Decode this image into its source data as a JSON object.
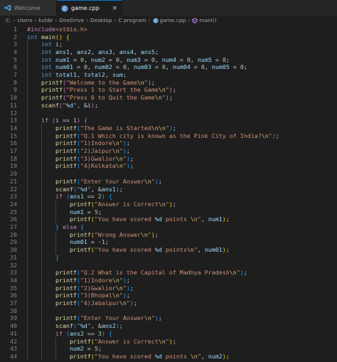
{
  "tabs": [
    {
      "label": "Welcome",
      "active": false
    },
    {
      "label": "game.cpp",
      "active": true
    }
  ],
  "breadcrumb": [
    "C:",
    "Users",
    "kulde",
    "OneDrive",
    "Desktop",
    "C program",
    "game.cpp",
    "main()"
  ],
  "colors": {
    "background": "#1e1e1e",
    "keyword": "#569cd6",
    "function": "#dcdcaa",
    "string": "#ce9178",
    "number": "#b5cea8",
    "preprocessor": "#c586c0",
    "variable": "#9cdcfe",
    "line_number": "#858585"
  },
  "code_lines": [
    [
      [
        "pp",
        "#include"
      ],
      [
        "st",
        "<stdio.h>"
      ]
    ],
    [
      [
        "ty",
        "int "
      ],
      [
        "fn",
        "main"
      ],
      [
        "br1",
        "() {"
      ]
    ],
    [
      [
        "ty",
        "    int "
      ],
      [
        "va",
        "i"
      ],
      [
        "pl",
        ";"
      ]
    ],
    [
      [
        "ty",
        "    int "
      ],
      [
        "va",
        "ans1"
      ],
      [
        "pl",
        ", "
      ],
      [
        "va",
        "ans2"
      ],
      [
        "pl",
        ", "
      ],
      [
        "va",
        "ans3"
      ],
      [
        "pl",
        ", "
      ],
      [
        "va",
        "ans4"
      ],
      [
        "pl",
        ", "
      ],
      [
        "va",
        "ans5"
      ],
      [
        "pl",
        ";"
      ]
    ],
    [
      [
        "ty",
        "    int "
      ],
      [
        "va",
        "num1"
      ],
      [
        "pl",
        " = "
      ],
      [
        "nu",
        "0"
      ],
      [
        "pl",
        ", "
      ],
      [
        "va",
        "num2"
      ],
      [
        "pl",
        " = "
      ],
      [
        "nu",
        "0"
      ],
      [
        "pl",
        ", "
      ],
      [
        "va",
        "num3"
      ],
      [
        "pl",
        " = "
      ],
      [
        "nu",
        "0"
      ],
      [
        "pl",
        ", "
      ],
      [
        "va",
        "num4"
      ],
      [
        "pl",
        " = "
      ],
      [
        "nu",
        "0"
      ],
      [
        "pl",
        ", "
      ],
      [
        "va",
        "num5"
      ],
      [
        "pl",
        " = "
      ],
      [
        "nu",
        "0"
      ],
      [
        "pl",
        ";"
      ]
    ],
    [
      [
        "ty",
        "    int "
      ],
      [
        "va",
        "num01"
      ],
      [
        "pl",
        " = "
      ],
      [
        "nu",
        "0"
      ],
      [
        "pl",
        ", "
      ],
      [
        "va",
        "num02"
      ],
      [
        "pl",
        " = "
      ],
      [
        "nu",
        "0"
      ],
      [
        "pl",
        ", "
      ],
      [
        "va",
        "num03"
      ],
      [
        "pl",
        " = "
      ],
      [
        "nu",
        "0"
      ],
      [
        "pl",
        ", "
      ],
      [
        "va",
        "num04"
      ],
      [
        "pl",
        " = "
      ],
      [
        "nu",
        "0"
      ],
      [
        "pl",
        ", "
      ],
      [
        "va",
        "num05"
      ],
      [
        "pl",
        " = "
      ],
      [
        "nu",
        "0"
      ],
      [
        "pl",
        ";"
      ]
    ],
    [
      [
        "ty",
        "    int "
      ],
      [
        "va",
        "total1"
      ],
      [
        "pl",
        ", "
      ],
      [
        "va",
        "total2"
      ],
      [
        "pl",
        ", "
      ],
      [
        "va",
        "sum"
      ],
      [
        "pl",
        ";"
      ]
    ],
    [
      [
        "fn",
        "    printf"
      ],
      [
        "br2",
        "("
      ],
      [
        "st",
        "\"Welcome to the Game"
      ],
      [
        "es",
        "\\n"
      ],
      [
        "st",
        "\""
      ],
      [
        "br2",
        ")"
      ],
      [
        "pl",
        ";"
      ]
    ],
    [
      [
        "fn",
        "    printf"
      ],
      [
        "br2",
        "("
      ],
      [
        "st",
        "\"Press 1 to Start the Game"
      ],
      [
        "es",
        "\\n"
      ],
      [
        "st",
        "\""
      ],
      [
        "br2",
        ")"
      ],
      [
        "pl",
        ";"
      ]
    ],
    [
      [
        "fn",
        "    printf"
      ],
      [
        "br2",
        "("
      ],
      [
        "st",
        "\"Press 0 to Quit the Game"
      ],
      [
        "es",
        "\\n"
      ],
      [
        "st",
        "\""
      ],
      [
        "br2",
        ")"
      ],
      [
        "pl",
        ";"
      ]
    ],
    [
      [
        "fn",
        "    scanf"
      ],
      [
        "br2",
        "("
      ],
      [
        "st",
        "\""
      ],
      [
        "va",
        "%d"
      ],
      [
        "st",
        "\""
      ],
      [
        "pl",
        ", &"
      ],
      [
        "va",
        "i"
      ],
      [
        "br2",
        ")"
      ],
      [
        "pl",
        ";"
      ]
    ],
    [],
    [
      [
        "pp",
        "    if "
      ],
      [
        "br2",
        "("
      ],
      [
        "va",
        "i"
      ],
      [
        "pl",
        " == "
      ],
      [
        "nu",
        "1"
      ],
      [
        "br2",
        ")"
      ],
      [
        "br2",
        " {"
      ]
    ],
    [
      [
        "fn",
        "        printf"
      ],
      [
        "br3",
        "("
      ],
      [
        "st",
        "\"The Game is Started"
      ],
      [
        "es",
        "\\n\\n"
      ],
      [
        "st",
        "\""
      ],
      [
        "br3",
        ")"
      ],
      [
        "pl",
        ";"
      ]
    ],
    [
      [
        "fn",
        "        printf"
      ],
      [
        "br3",
        "("
      ],
      [
        "st",
        "\"Q.1 Which city is known as the Pink City of India?"
      ],
      [
        "es",
        "\\n"
      ],
      [
        "st",
        "\""
      ],
      [
        "br3",
        ")"
      ],
      [
        "pl",
        ";"
      ]
    ],
    [
      [
        "fn",
        "        printf"
      ],
      [
        "br3",
        "("
      ],
      [
        "st",
        "\"1)Indore"
      ],
      [
        "es",
        "\\n"
      ],
      [
        "st",
        "\""
      ],
      [
        "br3",
        ")"
      ],
      [
        "pl",
        ";"
      ]
    ],
    [
      [
        "fn",
        "        printf"
      ],
      [
        "br3",
        "("
      ],
      [
        "st",
        "\"2)Jaipur"
      ],
      [
        "es",
        "\\n"
      ],
      [
        "st",
        "\""
      ],
      [
        "br3",
        ")"
      ],
      [
        "pl",
        ";"
      ]
    ],
    [
      [
        "fn",
        "        printf"
      ],
      [
        "br3",
        "("
      ],
      [
        "st",
        "\"3)Gwalior"
      ],
      [
        "es",
        "\\n"
      ],
      [
        "st",
        "\""
      ],
      [
        "br3",
        ")"
      ],
      [
        "pl",
        ";"
      ]
    ],
    [
      [
        "fn",
        "        printf"
      ],
      [
        "br3",
        "("
      ],
      [
        "st",
        "\"4)Kolkata"
      ],
      [
        "es",
        "\\n"
      ],
      [
        "st",
        "\""
      ],
      [
        "br3",
        ")"
      ],
      [
        "pl",
        ";"
      ]
    ],
    [],
    [
      [
        "fn",
        "        printf"
      ],
      [
        "br3",
        "("
      ],
      [
        "st",
        "\"Enter Your Answer"
      ],
      [
        "es",
        "\\n"
      ],
      [
        "st",
        "\""
      ],
      [
        "br3",
        ")"
      ],
      [
        "pl",
        ";"
      ]
    ],
    [
      [
        "fn",
        "        scanf"
      ],
      [
        "br3",
        "("
      ],
      [
        "st",
        "\""
      ],
      [
        "va",
        "%d"
      ],
      [
        "st",
        "\""
      ],
      [
        "pl",
        ", &"
      ],
      [
        "va",
        "ans1"
      ],
      [
        "br3",
        ")"
      ],
      [
        "pl",
        ";"
      ]
    ],
    [
      [
        "pp",
        "        if "
      ],
      [
        "br3",
        "("
      ],
      [
        "va",
        "ans1"
      ],
      [
        "pl",
        " == "
      ],
      [
        "nu",
        "2"
      ],
      [
        "br3",
        ")"
      ],
      [
        "br3",
        " {"
      ]
    ],
    [
      [
        "fn",
        "            printf"
      ],
      [
        "br1",
        "("
      ],
      [
        "st",
        "\"Answer is Correct"
      ],
      [
        "es",
        "\\n"
      ],
      [
        "st",
        "\""
      ],
      [
        "br1",
        ")"
      ],
      [
        "pl",
        ";"
      ]
    ],
    [
      [
        "va",
        "            num1"
      ],
      [
        "pl",
        " = "
      ],
      [
        "nu",
        "5"
      ],
      [
        "pl",
        ";"
      ]
    ],
    [
      [
        "fn",
        "            printf"
      ],
      [
        "br1",
        "("
      ],
      [
        "st",
        "\"You have scored "
      ],
      [
        "va",
        "%d"
      ],
      [
        "st",
        " points "
      ],
      [
        "es",
        "\\n"
      ],
      [
        "st",
        "\""
      ],
      [
        "pl",
        ", "
      ],
      [
        "va",
        "num1"
      ],
      [
        "br1",
        ")"
      ],
      [
        "pl",
        ";"
      ]
    ],
    [
      [
        "br3",
        "        } "
      ],
      [
        "pp",
        "else "
      ],
      [
        "br3",
        "{"
      ]
    ],
    [
      [
        "fn",
        "            printf"
      ],
      [
        "br1",
        "("
      ],
      [
        "st",
        "\"Wrong Answer"
      ],
      [
        "es",
        "\\n"
      ],
      [
        "st",
        "\""
      ],
      [
        "br1",
        ")"
      ],
      [
        "pl",
        ";"
      ]
    ],
    [
      [
        "va",
        "            num01"
      ],
      [
        "pl",
        " = -"
      ],
      [
        "nu",
        "1"
      ],
      [
        "pl",
        ";"
      ]
    ],
    [
      [
        "fn",
        "            printf"
      ],
      [
        "br1",
        "("
      ],
      [
        "st",
        "\"You have scored "
      ],
      [
        "va",
        "%d"
      ],
      [
        "st",
        " points"
      ],
      [
        "es",
        "\\n"
      ],
      [
        "st",
        "\""
      ],
      [
        "pl",
        ", "
      ],
      [
        "va",
        "num01"
      ],
      [
        "br1",
        ")"
      ],
      [
        "pl",
        ";"
      ]
    ],
    [
      [
        "br3",
        "        }"
      ]
    ],
    [],
    [
      [
        "fn",
        "        printf"
      ],
      [
        "br3",
        "("
      ],
      [
        "st",
        "\"Q.2 What is the Capital of Madhya Pradesh"
      ],
      [
        "es",
        "\\n"
      ],
      [
        "st",
        "\""
      ],
      [
        "br3",
        ")"
      ],
      [
        "pl",
        ";"
      ]
    ],
    [
      [
        "fn",
        "        printf"
      ],
      [
        "br3",
        "("
      ],
      [
        "st",
        "\"1)Indore"
      ],
      [
        "es",
        "\\n"
      ],
      [
        "st",
        "\""
      ],
      [
        "br3",
        ")"
      ],
      [
        "pl",
        ";"
      ]
    ],
    [
      [
        "fn",
        "        printf"
      ],
      [
        "br3",
        "("
      ],
      [
        "st",
        "\"2)Gwalior"
      ],
      [
        "es",
        "\\n"
      ],
      [
        "st",
        "\""
      ],
      [
        "br3",
        ")"
      ],
      [
        "pl",
        ";"
      ]
    ],
    [
      [
        "fn",
        "        printf"
      ],
      [
        "br3",
        "("
      ],
      [
        "st",
        "\"3)Bhopal"
      ],
      [
        "es",
        "\\n"
      ],
      [
        "st",
        "\""
      ],
      [
        "br3",
        ")"
      ],
      [
        "pl",
        ";"
      ]
    ],
    [
      [
        "fn",
        "        printf"
      ],
      [
        "br3",
        "("
      ],
      [
        "st",
        "\"4)Jabalpur"
      ],
      [
        "es",
        "\\n"
      ],
      [
        "st",
        "\""
      ],
      [
        "br3",
        ")"
      ],
      [
        "pl",
        ";"
      ]
    ],
    [],
    [
      [
        "fn",
        "        printf"
      ],
      [
        "br3",
        "("
      ],
      [
        "st",
        "\"Enter Your Answer"
      ],
      [
        "es",
        "\\n"
      ],
      [
        "st",
        "\""
      ],
      [
        "br3",
        ")"
      ],
      [
        "pl",
        ";"
      ]
    ],
    [
      [
        "fn",
        "        scanf"
      ],
      [
        "br3",
        "("
      ],
      [
        "st",
        "\""
      ],
      [
        "va",
        "%d"
      ],
      [
        "st",
        "\""
      ],
      [
        "pl",
        ", &"
      ],
      [
        "va",
        "ans2"
      ],
      [
        "br3",
        ")"
      ],
      [
        "pl",
        ";"
      ]
    ],
    [
      [
        "pp",
        "        if "
      ],
      [
        "br3",
        "("
      ],
      [
        "va",
        "ans2"
      ],
      [
        "pl",
        " == "
      ],
      [
        "nu",
        "3"
      ],
      [
        "br3",
        ")"
      ],
      [
        "br3",
        " {"
      ]
    ],
    [
      [
        "fn",
        "            printf"
      ],
      [
        "br1",
        "("
      ],
      [
        "st",
        "\"Answer is Correct"
      ],
      [
        "es",
        "\\n"
      ],
      [
        "st",
        "\""
      ],
      [
        "br1",
        ")"
      ],
      [
        "pl",
        ";"
      ]
    ],
    [
      [
        "va",
        "            num2"
      ],
      [
        "pl",
        " = "
      ],
      [
        "nu",
        "5"
      ],
      [
        "pl",
        ";"
      ]
    ],
    [
      [
        "fn",
        "            printf"
      ],
      [
        "br1",
        "("
      ],
      [
        "st",
        "\"You have scored "
      ],
      [
        "va",
        "%d"
      ],
      [
        "st",
        " points "
      ],
      [
        "es",
        "\\n"
      ],
      [
        "st",
        "\""
      ],
      [
        "pl",
        ", "
      ],
      [
        "va",
        "num2"
      ],
      [
        "br1",
        ")"
      ],
      [
        "pl",
        ";"
      ]
    ]
  ]
}
